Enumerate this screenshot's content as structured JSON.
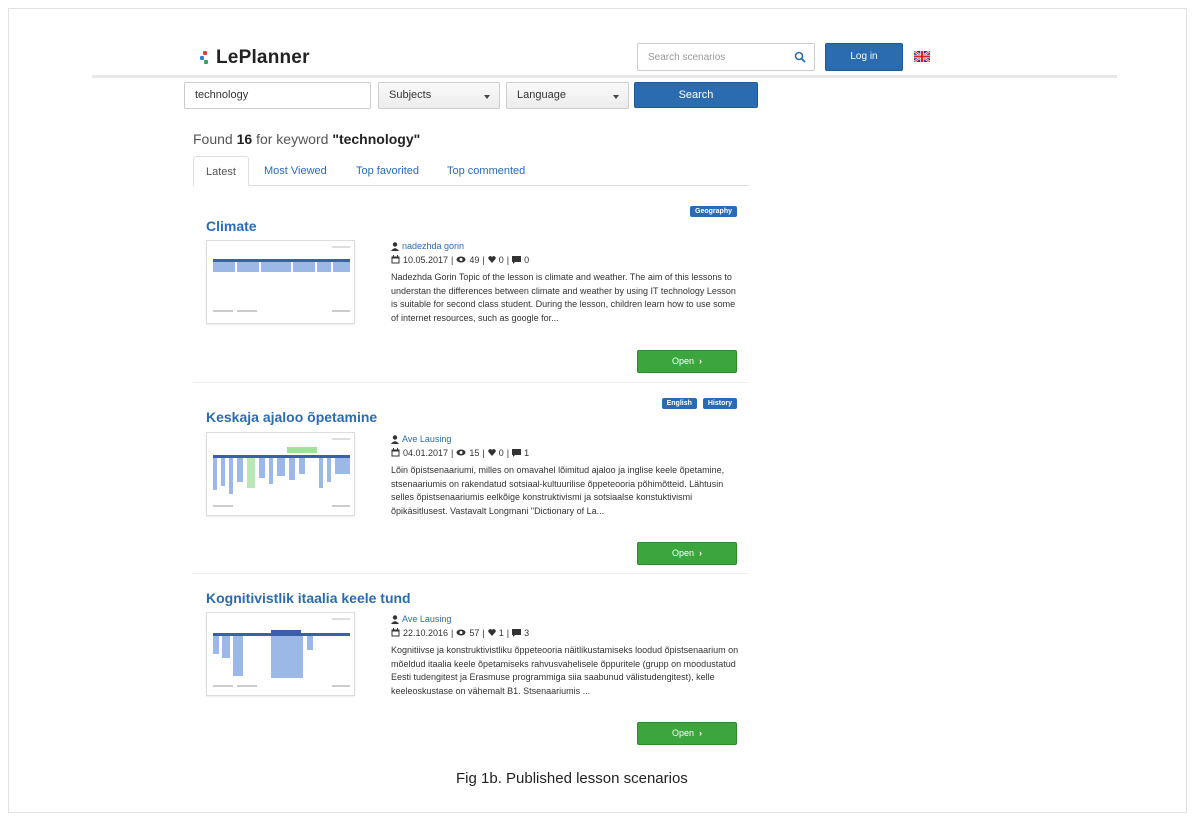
{
  "header": {
    "logo_text": "LePlanner",
    "search_placeholder": "Search scenarios",
    "login_label": "Log in",
    "language_flag": "uk-flag-icon"
  },
  "search": {
    "keyword_value": "technology",
    "subjects_label": "Subjects",
    "language_label": "Language",
    "search_button": "Search"
  },
  "found": {
    "prefix": "Found",
    "count": "16",
    "middle": "for keyword",
    "keyword": "\"technology\""
  },
  "tabs": [
    "Latest",
    "Most Viewed",
    "Top favorited",
    "Top commented"
  ],
  "results": [
    {
      "title": "Climate",
      "tags": [
        "Geography"
      ],
      "author": "nadezhda gorin",
      "date": "10.05.2017",
      "views": "49",
      "favorites": "0",
      "comments": "0",
      "description": "Nadezhda Gorin Topic of the lesson is climate and weather. The aim of this lessons to understan the differences between climate and weather by using IT technology Lesson is suitable for second class student. During the lesson, children learn how to use some of internet resources, such as google for...",
      "open_label": "Open"
    },
    {
      "title": "Keskaja ajaloo õpetamine",
      "tags": [
        "English",
        "History"
      ],
      "author": "Ave Lausing",
      "date": "04.01.2017",
      "views": "15",
      "favorites": "0",
      "comments": "1",
      "description": "Lõin õpistsenaariumi, milles on omavahel lõimitud ajaloo ja inglise keele õpetamine, stsenaariumis on rakendatud sotsiaal-kultuurilise õppeteooria põhimõtteid. Lähtusin selles õpistsenaariumis eelkõige konstruktivismi ja sotsiaalse konstuktivismi õpikäsitlusest. Vastavalt Longmani \"Dictionary of La...",
      "open_label": "Open"
    },
    {
      "title": "Kognitivistlik itaalia keele tund",
      "tags": [],
      "author": "Ave Lausing",
      "date": "22.10.2016",
      "views": "57",
      "favorites": "1",
      "comments": "3",
      "description": "Kognitiivse ja konstruktivistliku õppeteooria näitlikustamiseks loodud õpistsenaarium on mõeldud itaalia keele õpetamiseks rahvusvahelisele õppuritele (grupp on moodustatud Eesti tudengitest ja Erasmuse programmiga siia saabunud välistudengitest), kelle keeleoskustase on vähemalt B1. Stsenaariumis ...",
      "open_label": "Open"
    }
  ],
  "caption": "Fig 1b. Published lesson scenarios",
  "colors": {
    "primary": "#2b6cb0",
    "open_button": "#3da53d",
    "link": "#2b6cb0"
  }
}
